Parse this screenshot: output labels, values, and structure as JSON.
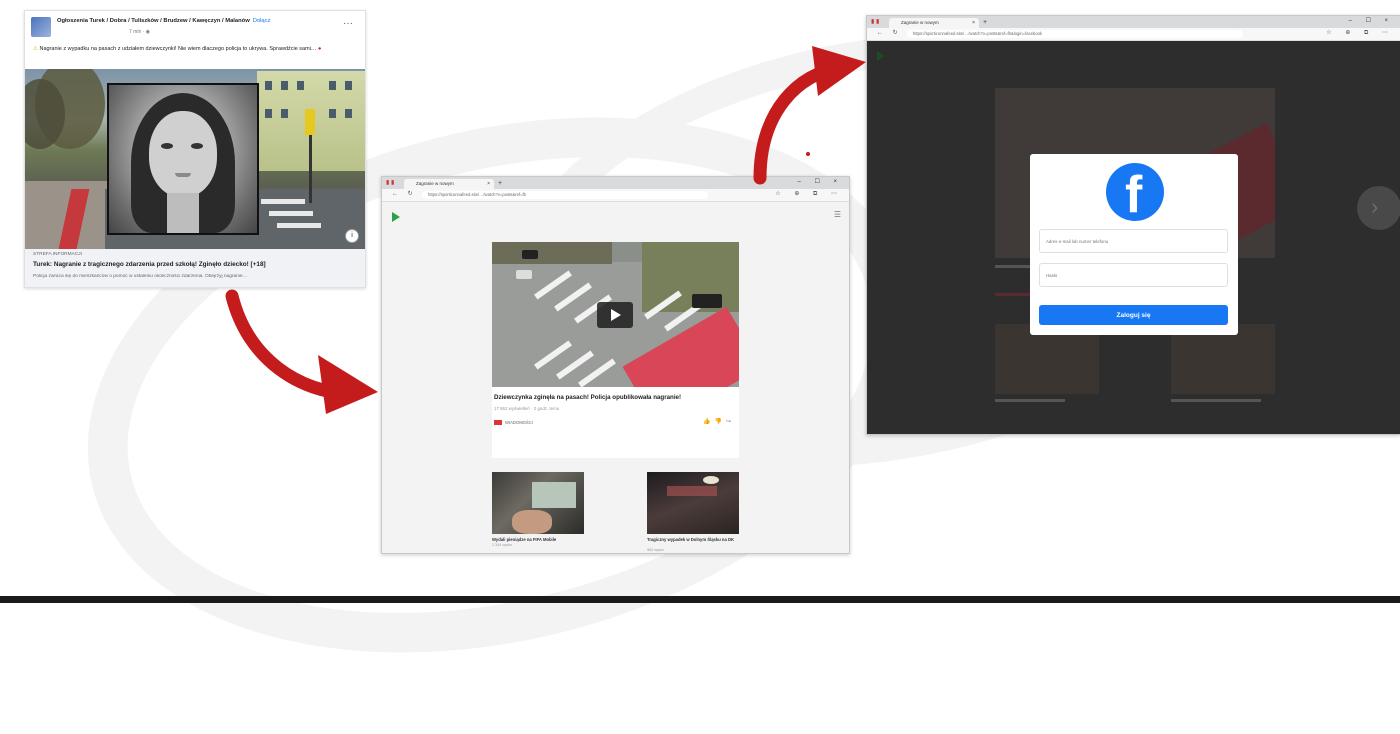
{
  "facebook_post": {
    "group_name": "Ogłoszenia Turek / Dobra / Tuliszków / Brudzew / Kawęczyn / Malanów",
    "join_label": "Dołącz",
    "time": "7 min · ",
    "text": "Nagranie z wypadku na pasach z udziałem dziewczynki! Nie wiem dlaczego policja to ukrywa. Sprawdźcie sami…",
    "link_domain": "STREFA INFORMACJI",
    "link_title": "Turek: Nagranie z tragicznego zdarzenia przed szkołą! Zginęło dziecko! [+18]",
    "link_description": "Policja zwraca się do mieszkańców o pomoc w ustaleniu okoliczności zdarzenia. Obejrzyj nagranie…"
  },
  "browser_video": {
    "tab_title": "Zagranie w nowym",
    "url": "https://sporticonnafeed.site/…/watch?v=posts&ref=fb",
    "video_title": "Dziewczynka zginęła na pasach! Policja opublikowała nagranie!",
    "views": "17 862 wyświetleń · 2 godz. temu",
    "channel": "WIADOMOŚCI",
    "related": [
      {
        "title": "Wydali pieniądze na FIFA Mobile",
        "sub": "1 344 wyśw."
      },
      {
        "title": "Tragiczny wypadek w Dolnym Śląsku na DK",
        "sub": "962 wyśw."
      }
    ]
  },
  "browser_login": {
    "tab_title": "Zagranie w nowym",
    "url": "https://sporticonnafeed.site/…/watch?v=posts&ref=fb&login=facebook",
    "email_placeholder": "Adres e-mail lub numer telefonu",
    "password_placeholder": "Hasło",
    "login_button": "Zaloguj się"
  },
  "colors": {
    "facebook_blue": "#1877f2",
    "arrow_red": "#c41c1c"
  }
}
